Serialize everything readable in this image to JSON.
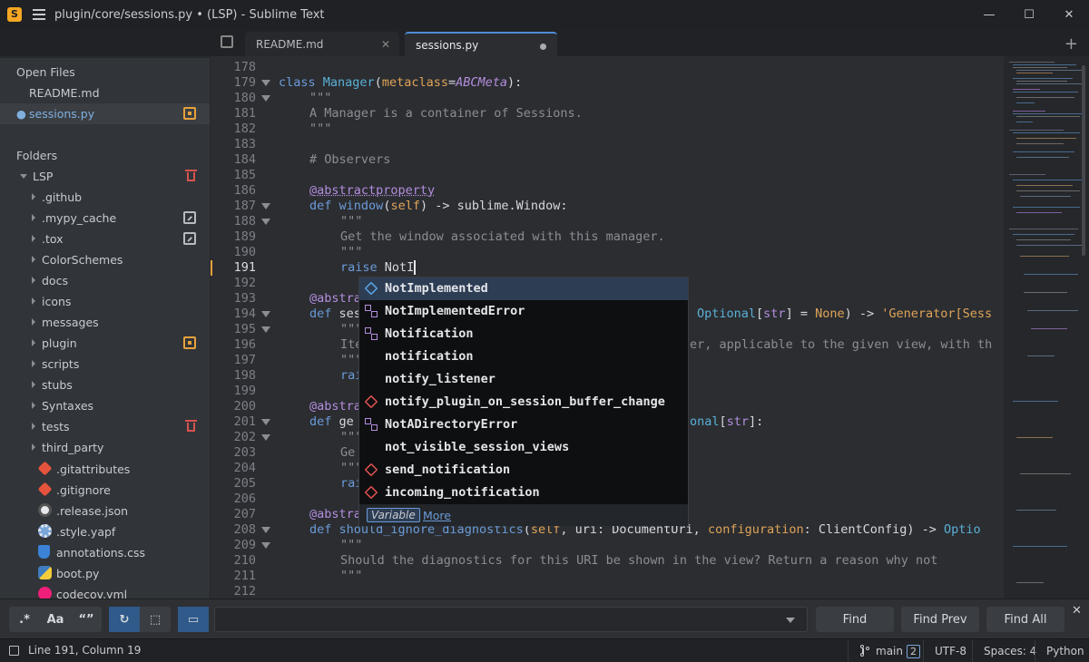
{
  "window": {
    "title": "plugin/core/sessions.py • (LSP) - Sublime Text",
    "app_icon": "S",
    "controls": [
      "—",
      "☐",
      "✕"
    ]
  },
  "tabs": [
    {
      "label": "README.md",
      "close": "✕"
    },
    {
      "label": "sessions.py",
      "active": true
    }
  ],
  "new_tab": "+",
  "sidebar": {
    "open_files_heading": "Open Files",
    "open_files": [
      {
        "label": "README.md",
        "dot": ""
      },
      {
        "label": "sessions.py",
        "dot": "●"
      }
    ],
    "folders_heading": "Folders",
    "root": "LSP",
    "folders": [
      ".github",
      ".mypy_cache",
      ".tox",
      "ColorSchemes",
      "docs",
      "icons",
      "messages",
      "plugin",
      "scripts",
      "stubs",
      "Syntaxes",
      "tests",
      "third_party"
    ],
    "files": [
      ".gitattributes",
      ".gitignore",
      ".release.json",
      ".style.yapf",
      "annotations.css",
      "boot.py",
      "codecov.yml"
    ],
    "colors": {
      "modified": "#e6a23c",
      "deleted": "#d9534f",
      "untracked": "#b8bcc2"
    }
  },
  "editor": {
    "current_line": "191",
    "line_numbers": [
      "178",
      "179",
      "180",
      "181",
      "182",
      "183",
      "184",
      "185",
      "186",
      "187",
      "188",
      "189",
      "190",
      "191",
      "192",
      "193",
      "194",
      "195",
      "196",
      "197",
      "198",
      "199",
      "200",
      "201",
      "202",
      "203",
      "204",
      "205",
      "206",
      "207",
      "208",
      "209",
      "210",
      "211",
      "212"
    ],
    "lines": {
      "l179": {
        "kw": "class",
        "name": "Manager",
        "open": "(",
        "param": "metaclass",
        "eq": "=",
        "meta": "ABCMeta",
        "close": "):"
      },
      "l180": "\"\"\"",
      "l181": "A Manager is a container of Sessions.",
      "l182": "\"\"\"",
      "l184": "# Observers",
      "l186": "@abstractproperty",
      "l187": {
        "kw": "def",
        "name": "window",
        "open": "(",
        "self": "self",
        "rest": ") -> sublime.Window:"
      },
      "l188": "\"\"\"",
      "l189": "Get the window associated with this manager.",
      "l190": "\"\"\"",
      "l191": {
        "kw": "raise",
        "text": " NotI"
      },
      "l193": "@abstra",
      "l194": {
        "kw": "def",
        "text": " ses",
        "opt": "Optional",
        "lb": "[",
        "str": "str",
        "rb": "]",
        "eq": " = ",
        "none": "None",
        "arrow": ") -> ",
        "gen": "'Generator[Sess"
      },
      "l195": "\"\"\"",
      "l196": {
        "a": "Ite",
        "b": "er, applicable to the given view, with th"
      },
      "l197": "\"\"\"",
      "l198": "rai",
      "l200": "@abstra",
      "l201": {
        "kw": "def",
        "text": " ge",
        "opt": "onal",
        "lb": "[",
        "str": "str",
        "rb": "]:"
      },
      "l202": "\"\"\"",
      "l203": "Ge",
      "l204": "\"\"\"",
      "l205": "rai",
      "l207": "@abstra",
      "l208": {
        "kw": "def",
        "name": " should_ignore_diagnostics",
        "open": "(",
        "self": "self",
        "mid": ", uri: DocumentUri, ",
        "param": "configuration",
        "rest": ": ClientConfig) -> ",
        "opt": "Optio"
      },
      "l209": "\"\"\"",
      "l210": "Should the diagnostics for this URI be shown in the view? Return a reason why not",
      "l211": "\"\"\""
    }
  },
  "autocomplete": {
    "items": [
      {
        "label": "NotImplemented",
        "icon": "variable-icon"
      },
      {
        "label": "NotImplementedError",
        "icon": "class-icon"
      },
      {
        "label": "Notification",
        "icon": "class-icon"
      },
      {
        "label": "notification",
        "icon": "none"
      },
      {
        "label": "notify_listener",
        "icon": "none"
      },
      {
        "label": "notify_plugin_on_session_buffer_change",
        "icon": "method-icon"
      },
      {
        "label": "NotADirectoryError",
        "icon": "class-icon"
      },
      {
        "label": "not_visible_session_views",
        "icon": "none"
      },
      {
        "label": "send_notification",
        "icon": "method-icon"
      },
      {
        "label": "incoming_notification",
        "icon": "method-icon"
      }
    ],
    "kind": "Variable",
    "more": "More"
  },
  "find": {
    "regex": ".*",
    "case": "Aa",
    "word": "“”",
    "wrap": "↻",
    "in_selection": "⬚",
    "highlight": "▭",
    "input_value": "",
    "find": "Find",
    "find_prev": "Find Prev",
    "find_all": "Find All",
    "close": "✕"
  },
  "status": {
    "position": "Line 191, Column 19",
    "branch": "main",
    "branch_count": "2",
    "encoding": "UTF-8",
    "indent": "Spaces: 4",
    "syntax": "Python"
  }
}
